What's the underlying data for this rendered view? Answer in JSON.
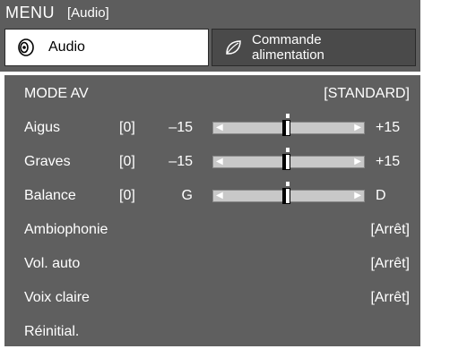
{
  "menu": {
    "title": "MENU",
    "subtitle": "[Audio]"
  },
  "tabs": [
    {
      "label": "Audio",
      "icon": "speaker-icon",
      "selected": true
    },
    {
      "label_line1": "Commande",
      "label_line2": "alimentation",
      "icon": "leaf-icon",
      "selected": false
    }
  ],
  "rows": {
    "mode_av": {
      "label": "MODE AV",
      "value": "[STANDARD]"
    },
    "aigus": {
      "label": "Aigus",
      "value": "[0]",
      "min": "–15",
      "max": "+15",
      "level": 0
    },
    "graves": {
      "label": "Graves",
      "value": "[0]",
      "min": "–15",
      "max": "+15",
      "level": 0
    },
    "balance": {
      "label": "Balance",
      "value": "[0]",
      "min": "G",
      "max": "D",
      "level": 0
    },
    "ambiophonie": {
      "label": "Ambiophonie",
      "value": "[Arrêt]"
    },
    "vol_auto": {
      "label": "Vol. auto",
      "value": "[Arrêt]"
    },
    "voix_claire": {
      "label": "Voix claire",
      "value": "[Arrêt]"
    },
    "reinitial": {
      "label": "Réinitial."
    }
  },
  "colors": {
    "background": "#5f5f5f",
    "header": "#5d5d5d",
    "text": "#ffffff",
    "track": "#c8c8c8"
  }
}
